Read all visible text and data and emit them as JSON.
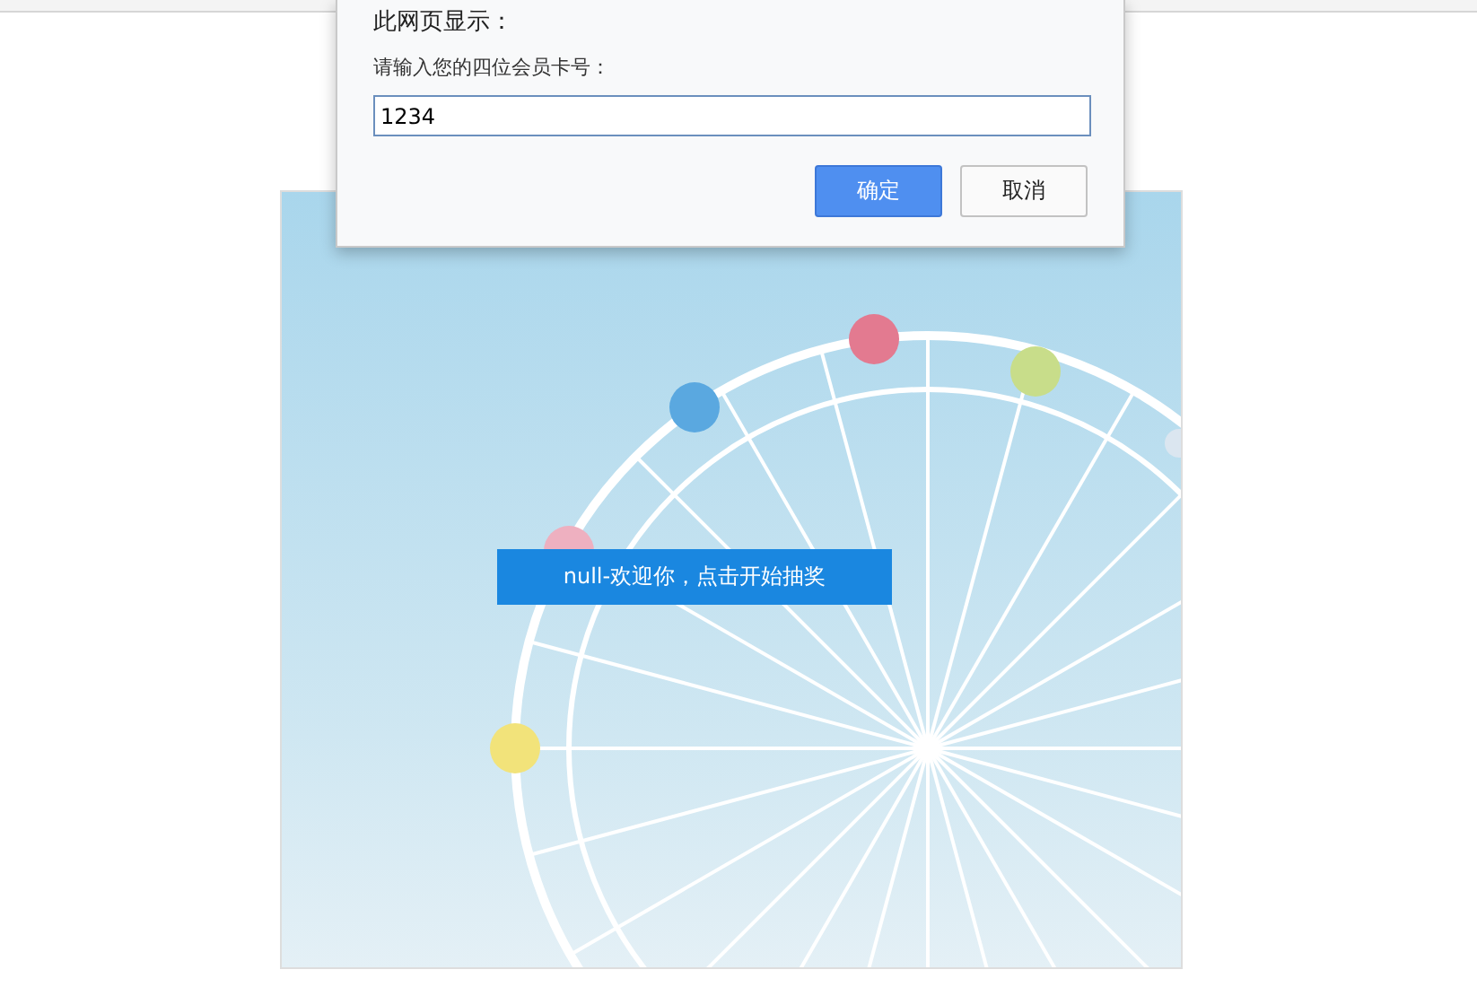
{
  "dialog": {
    "title": "此网页显示：",
    "prompt": "请输入您的四位会员卡号：",
    "input": {
      "value": "1234"
    },
    "buttons": [
      {
        "label": "确定",
        "kind": "primary"
      },
      {
        "label": "取消",
        "kind": "secondary"
      }
    ]
  },
  "start_button": {
    "label": "null-欢迎你，点击开始抽奖"
  }
}
